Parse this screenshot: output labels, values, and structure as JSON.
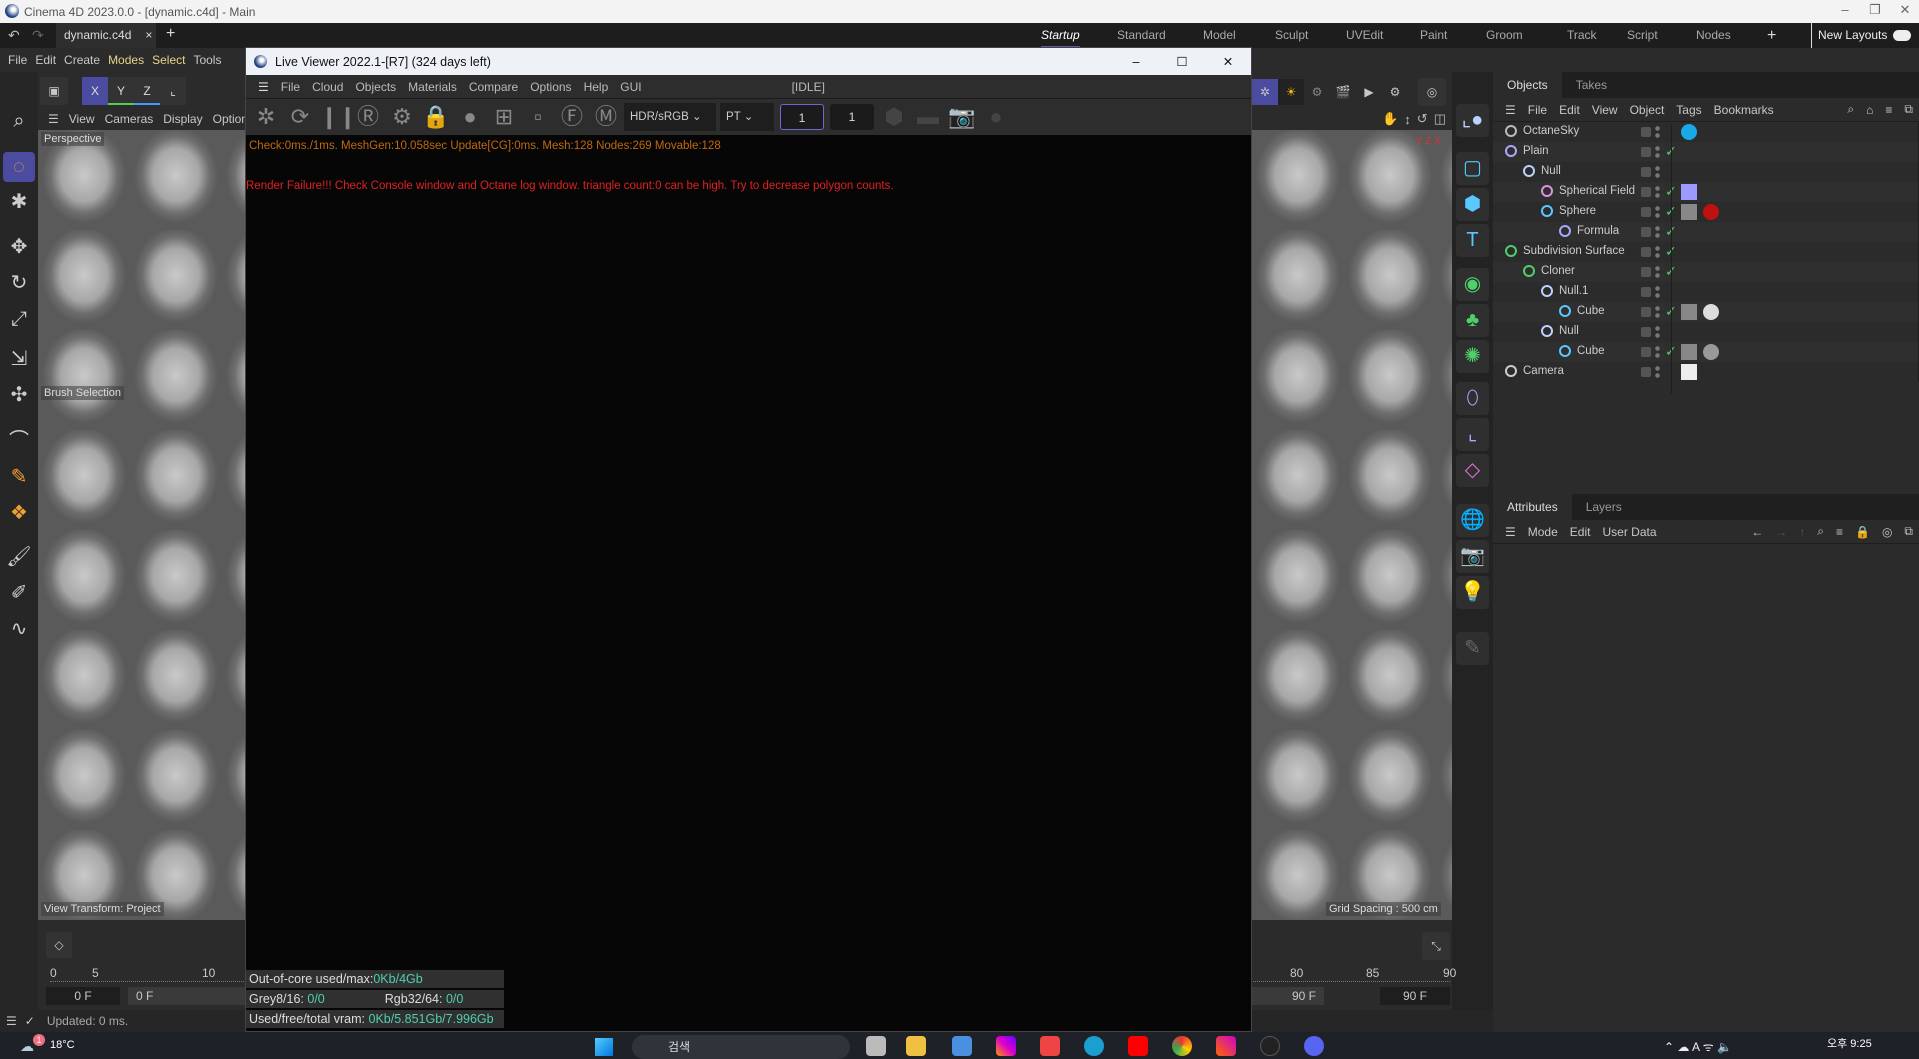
{
  "app": {
    "title": "Cinema 4D 2023.0.0 - [dynamic.c4d] - Main",
    "doc_tab": "dynamic.c4d",
    "layouts": [
      "Startup",
      "Standard",
      "Model",
      "Sculpt",
      "UVEdit",
      "Paint",
      "Groom",
      "Track",
      "Script",
      "Nodes"
    ],
    "active_layout": "Startup",
    "new_layouts": "New Layouts"
  },
  "menu": [
    "File",
    "Edit",
    "Create",
    "Modes",
    "Select",
    "Tools"
  ],
  "axis": {
    "x": "X",
    "y": "Y",
    "z": "Z"
  },
  "viewport": {
    "menu": [
      "View",
      "Cameras",
      "Display",
      "Option"
    ],
    "camera": "Perspective",
    "brush": "Brush Selection",
    "view_transform": "View Transform: Project",
    "grid_spacing": "Grid Spacing : 500 cm"
  },
  "live_viewer": {
    "title": "Live Viewer 2022.1-[R7] (324 days left)",
    "menu": [
      "File",
      "Cloud",
      "Objects",
      "Materials",
      "Compare",
      "Options",
      "Help",
      "GUI"
    ],
    "status": "[IDLE]",
    "color_space": "HDR/sRGB",
    "kernel": "PT",
    "field1": "1",
    "field2": "1",
    "check_msg": "Check:0ms./1ms. MeshGen:10.058sec Update[CG]:0ms. Mesh:128 Nodes:269 Movable:128",
    "error_msg": "Render Failure!!! Check Console window and Octane log window.  triangle count:0 can be high. Try to decrease polygon counts.",
    "out_of_core_label": "Out-of-core used/max:",
    "out_of_core_value": "0Kb/4Gb",
    "grey_label": "Grey8/16:",
    "grey_value": "0/0",
    "rgb_label": "Rgb32/64:",
    "rgb_value": "0/0",
    "vram_label": "Used/free/total vram:",
    "vram_value": "0Kb/5.851Gb/7.996Gb",
    "error_color": "#e02020",
    "check_color": "#c06a10"
  },
  "objects": {
    "tabs": [
      "Objects",
      "Takes"
    ],
    "menu": [
      "File",
      "Edit",
      "View",
      "Object",
      "Tags",
      "Bookmarks"
    ],
    "rows": [
      {
        "name": "OctaneSky",
        "depth": 0,
        "icon": "globe-icon",
        "check": false
      },
      {
        "name": "Plain",
        "depth": 0,
        "icon": "plain-effector-icon",
        "check": true
      },
      {
        "name": "Null",
        "depth": 1,
        "icon": "null-icon",
        "check": false
      },
      {
        "name": "Spherical Field",
        "depth": 2,
        "icon": "spherical-field-icon",
        "check": true
      },
      {
        "name": "Sphere",
        "depth": 2,
        "icon": "sphere-icon",
        "check": true
      },
      {
        "name": "Formula",
        "depth": 3,
        "icon": "formula-icon",
        "check": true
      },
      {
        "name": "Subdivision Surface",
        "depth": 0,
        "icon": "subdivision-icon",
        "check": true
      },
      {
        "name": "Cloner",
        "depth": 1,
        "icon": "cloner-icon",
        "check": true
      },
      {
        "name": "Null.1",
        "depth": 2,
        "icon": "null-icon",
        "check": false
      },
      {
        "name": "Cube",
        "depth": 3,
        "icon": "cube-icon",
        "check": true
      },
      {
        "name": "Null",
        "depth": 2,
        "icon": "null-icon",
        "check": false
      },
      {
        "name": "Cube",
        "depth": 3,
        "icon": "cube-icon",
        "check": true
      },
      {
        "name": "Camera",
        "depth": 0,
        "icon": "camera-icon",
        "check": false
      }
    ]
  },
  "attributes": {
    "tabs": [
      "Attributes",
      "Layers"
    ],
    "menu": [
      "Mode",
      "Edit",
      "User Data"
    ]
  },
  "timeline": {
    "ticks_left": [
      "0",
      "5",
      "10"
    ],
    "ticks_right": [
      "80",
      "85",
      "90"
    ],
    "start": "0 F",
    "current": "0 F",
    "end_a": "90 F",
    "end_b": "90 F"
  },
  "status": {
    "text": "Updated: 0 ms."
  },
  "taskbar": {
    "weather": "18°C",
    "weather_badge": "1",
    "search": "검색",
    "time": "오후 9:25"
  }
}
